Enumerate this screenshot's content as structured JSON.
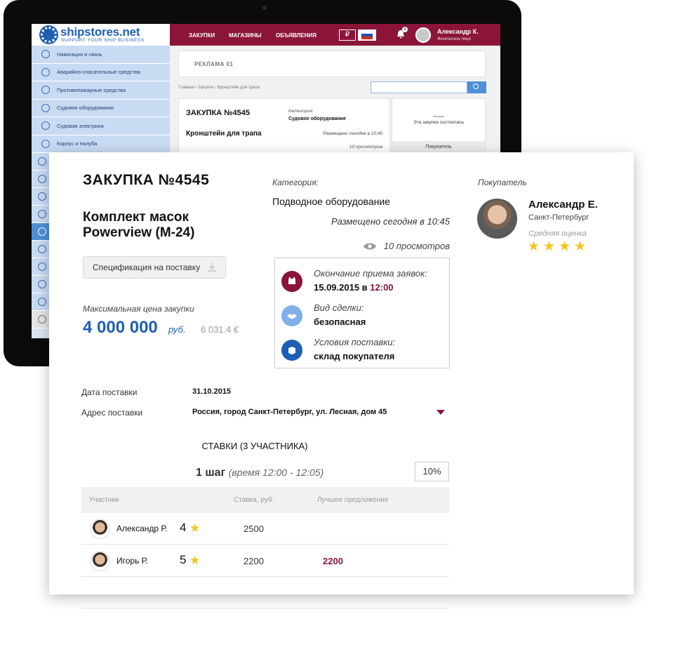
{
  "device": {
    "logo": {
      "title": "shipstores.net",
      "subtitle": "SUPPORT YOUR SHIP BUSINESS"
    },
    "nav": [
      "ЗАКУПКИ",
      "МАГАЗИНЫ",
      "ОБЪЯВЛЕНИЯ"
    ],
    "currency": "₽",
    "notifications_count": "1",
    "user": {
      "name": "Александр К.",
      "role": "Физическое лицо"
    },
    "sidebar": [
      {
        "label": "Навигация и связь",
        "icon": "compass-icon"
      },
      {
        "label": "Аварийно-спасательные средства",
        "icon": "lifebuoy-icon"
      },
      {
        "label": "Противопожарные средства",
        "icon": "fire-extinguisher-icon"
      },
      {
        "label": "Судовое оборудование",
        "icon": "gear-icon"
      },
      {
        "label": "Судовая электрика",
        "icon": "plug-icon"
      },
      {
        "label": "Корпус и палуба",
        "icon": "anchor-icon"
      }
    ],
    "ad_label": "РЕКЛАМА 01",
    "breadcrumbs": "Главная  ›  Закупки  ›  Кронштейн для трапа",
    "card": {
      "title": "ЗАКУПКА  №4545",
      "name": "Кронштейн для трапа",
      "category_label": "Категория:",
      "category": "Судовое оборудование",
      "placed": "Размещено сегодня в 10:45",
      "views": "10 просмотров",
      "status": "Эта закупка состоялась",
      "buyer_tab": "Покупатель"
    }
  },
  "detail": {
    "title": "ЗАКУПКА  №4545",
    "name": "Комплект масок Powerview (М-24)",
    "spec_button": "Спецификация на поставку",
    "max_price_label": "Максимальная цена закупки",
    "max_price": "4 000 000",
    "max_price_currency": "руб.",
    "max_price_eur": "6 031.4 €",
    "category_label": "Категория:",
    "category": "Подводное оборудование",
    "placed": "Размещено сегодня в 10:45",
    "views": "10 просмотров",
    "terms": {
      "deadline_label": "Окончание приема заявок:",
      "deadline_date": "15.09.2015 в ",
      "deadline_time": "12:00",
      "deal_label": "Вид сделки:",
      "deal_value": "безопасная",
      "delivery_label": "Условия поставки:",
      "delivery_value": "склад покупателя"
    },
    "buyer": {
      "label": "Покупатель",
      "name": "Александр Е.",
      "city": "Санкт-Петербург",
      "rating_label": "Средняя оценка",
      "rating": 4
    },
    "delivery_date_label": "Дата поставки",
    "delivery_date": "31.10.2015",
    "address_label": "Адрес поставки",
    "address": "Россия, город Санкт-Петербург, ул. Лесная, дом 45",
    "bids_title": "СТАВКИ (3 УЧАСТНИКА)",
    "step_label": "1 шаг",
    "step_time": "(время 12:00 - 12:05)",
    "step_percent": "10%",
    "table_headers": [
      "Участник",
      "Ставка, руб.",
      "Лучшее предложение"
    ],
    "bids": [
      {
        "name": "Александр Р.",
        "rank": "4",
        "bid": "2500",
        "best": ""
      },
      {
        "name": "Игорь Р.",
        "rank": "5",
        "bid": "2200",
        "best": "2200"
      }
    ]
  },
  "colors": {
    "brand": "#8a1538",
    "accent_blue": "#1e5fb4",
    "star": "#f4c51b"
  }
}
